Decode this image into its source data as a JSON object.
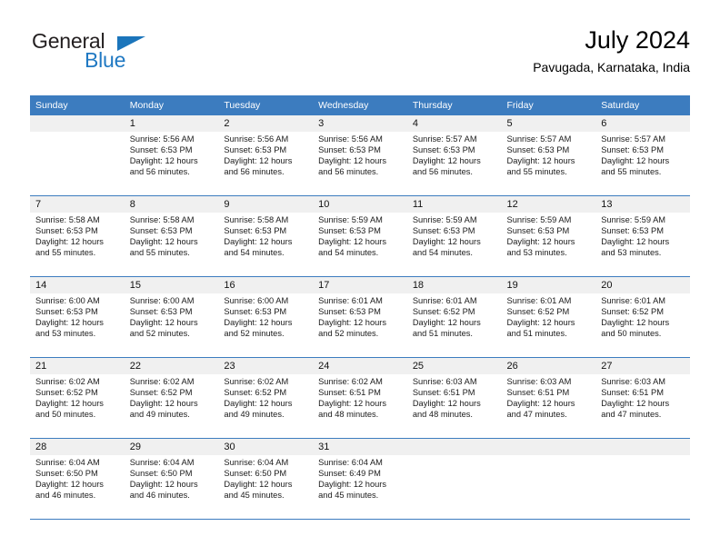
{
  "brand": {
    "name_part1": "General",
    "name_part2": "Blue",
    "triangle_icon": "triangle-icon",
    "accent_color": "#1b75bb"
  },
  "header": {
    "title": "July 2024",
    "subtitle": "Pavugada, Karnataka, India"
  },
  "calendar": {
    "header_color": "#3c7cbf",
    "daynum_bg": "#f0f0f0",
    "weekday_headers": [
      "Sunday",
      "Monday",
      "Tuesday",
      "Wednesday",
      "Thursday",
      "Friday",
      "Saturday"
    ],
    "weeks": [
      [
        {
          "day": "",
          "sunrise": "",
          "sunset": "",
          "daylight1": "",
          "daylight2": ""
        },
        {
          "day": "1",
          "sunrise": "Sunrise: 5:56 AM",
          "sunset": "Sunset: 6:53 PM",
          "daylight1": "Daylight: 12 hours",
          "daylight2": "and 56 minutes."
        },
        {
          "day": "2",
          "sunrise": "Sunrise: 5:56 AM",
          "sunset": "Sunset: 6:53 PM",
          "daylight1": "Daylight: 12 hours",
          "daylight2": "and 56 minutes."
        },
        {
          "day": "3",
          "sunrise": "Sunrise: 5:56 AM",
          "sunset": "Sunset: 6:53 PM",
          "daylight1": "Daylight: 12 hours",
          "daylight2": "and 56 minutes."
        },
        {
          "day": "4",
          "sunrise": "Sunrise: 5:57 AM",
          "sunset": "Sunset: 6:53 PM",
          "daylight1": "Daylight: 12 hours",
          "daylight2": "and 56 minutes."
        },
        {
          "day": "5",
          "sunrise": "Sunrise: 5:57 AM",
          "sunset": "Sunset: 6:53 PM",
          "daylight1": "Daylight: 12 hours",
          "daylight2": "and 55 minutes."
        },
        {
          "day": "6",
          "sunrise": "Sunrise: 5:57 AM",
          "sunset": "Sunset: 6:53 PM",
          "daylight1": "Daylight: 12 hours",
          "daylight2": "and 55 minutes."
        }
      ],
      [
        {
          "day": "7",
          "sunrise": "Sunrise: 5:58 AM",
          "sunset": "Sunset: 6:53 PM",
          "daylight1": "Daylight: 12 hours",
          "daylight2": "and 55 minutes."
        },
        {
          "day": "8",
          "sunrise": "Sunrise: 5:58 AM",
          "sunset": "Sunset: 6:53 PM",
          "daylight1": "Daylight: 12 hours",
          "daylight2": "and 55 minutes."
        },
        {
          "day": "9",
          "sunrise": "Sunrise: 5:58 AM",
          "sunset": "Sunset: 6:53 PM",
          "daylight1": "Daylight: 12 hours",
          "daylight2": "and 54 minutes."
        },
        {
          "day": "10",
          "sunrise": "Sunrise: 5:59 AM",
          "sunset": "Sunset: 6:53 PM",
          "daylight1": "Daylight: 12 hours",
          "daylight2": "and 54 minutes."
        },
        {
          "day": "11",
          "sunrise": "Sunrise: 5:59 AM",
          "sunset": "Sunset: 6:53 PM",
          "daylight1": "Daylight: 12 hours",
          "daylight2": "and 54 minutes."
        },
        {
          "day": "12",
          "sunrise": "Sunrise: 5:59 AM",
          "sunset": "Sunset: 6:53 PM",
          "daylight1": "Daylight: 12 hours",
          "daylight2": "and 53 minutes."
        },
        {
          "day": "13",
          "sunrise": "Sunrise: 5:59 AM",
          "sunset": "Sunset: 6:53 PM",
          "daylight1": "Daylight: 12 hours",
          "daylight2": "and 53 minutes."
        }
      ],
      [
        {
          "day": "14",
          "sunrise": "Sunrise: 6:00 AM",
          "sunset": "Sunset: 6:53 PM",
          "daylight1": "Daylight: 12 hours",
          "daylight2": "and 53 minutes."
        },
        {
          "day": "15",
          "sunrise": "Sunrise: 6:00 AM",
          "sunset": "Sunset: 6:53 PM",
          "daylight1": "Daylight: 12 hours",
          "daylight2": "and 52 minutes."
        },
        {
          "day": "16",
          "sunrise": "Sunrise: 6:00 AM",
          "sunset": "Sunset: 6:53 PM",
          "daylight1": "Daylight: 12 hours",
          "daylight2": "and 52 minutes."
        },
        {
          "day": "17",
          "sunrise": "Sunrise: 6:01 AM",
          "sunset": "Sunset: 6:53 PM",
          "daylight1": "Daylight: 12 hours",
          "daylight2": "and 52 minutes."
        },
        {
          "day": "18",
          "sunrise": "Sunrise: 6:01 AM",
          "sunset": "Sunset: 6:52 PM",
          "daylight1": "Daylight: 12 hours",
          "daylight2": "and 51 minutes."
        },
        {
          "day": "19",
          "sunrise": "Sunrise: 6:01 AM",
          "sunset": "Sunset: 6:52 PM",
          "daylight1": "Daylight: 12 hours",
          "daylight2": "and 51 minutes."
        },
        {
          "day": "20",
          "sunrise": "Sunrise: 6:01 AM",
          "sunset": "Sunset: 6:52 PM",
          "daylight1": "Daylight: 12 hours",
          "daylight2": "and 50 minutes."
        }
      ],
      [
        {
          "day": "21",
          "sunrise": "Sunrise: 6:02 AM",
          "sunset": "Sunset: 6:52 PM",
          "daylight1": "Daylight: 12 hours",
          "daylight2": "and 50 minutes."
        },
        {
          "day": "22",
          "sunrise": "Sunrise: 6:02 AM",
          "sunset": "Sunset: 6:52 PM",
          "daylight1": "Daylight: 12 hours",
          "daylight2": "and 49 minutes."
        },
        {
          "day": "23",
          "sunrise": "Sunrise: 6:02 AM",
          "sunset": "Sunset: 6:52 PM",
          "daylight1": "Daylight: 12 hours",
          "daylight2": "and 49 minutes."
        },
        {
          "day": "24",
          "sunrise": "Sunrise: 6:02 AM",
          "sunset": "Sunset: 6:51 PM",
          "daylight1": "Daylight: 12 hours",
          "daylight2": "and 48 minutes."
        },
        {
          "day": "25",
          "sunrise": "Sunrise: 6:03 AM",
          "sunset": "Sunset: 6:51 PM",
          "daylight1": "Daylight: 12 hours",
          "daylight2": "and 48 minutes."
        },
        {
          "day": "26",
          "sunrise": "Sunrise: 6:03 AM",
          "sunset": "Sunset: 6:51 PM",
          "daylight1": "Daylight: 12 hours",
          "daylight2": "and 47 minutes."
        },
        {
          "day": "27",
          "sunrise": "Sunrise: 6:03 AM",
          "sunset": "Sunset: 6:51 PM",
          "daylight1": "Daylight: 12 hours",
          "daylight2": "and 47 minutes."
        }
      ],
      [
        {
          "day": "28",
          "sunrise": "Sunrise: 6:04 AM",
          "sunset": "Sunset: 6:50 PM",
          "daylight1": "Daylight: 12 hours",
          "daylight2": "and 46 minutes."
        },
        {
          "day": "29",
          "sunrise": "Sunrise: 6:04 AM",
          "sunset": "Sunset: 6:50 PM",
          "daylight1": "Daylight: 12 hours",
          "daylight2": "and 46 minutes."
        },
        {
          "day": "30",
          "sunrise": "Sunrise: 6:04 AM",
          "sunset": "Sunset: 6:50 PM",
          "daylight1": "Daylight: 12 hours",
          "daylight2": "and 45 minutes."
        },
        {
          "day": "31",
          "sunrise": "Sunrise: 6:04 AM",
          "sunset": "Sunset: 6:49 PM",
          "daylight1": "Daylight: 12 hours",
          "daylight2": "and 45 minutes."
        },
        {
          "day": "",
          "sunrise": "",
          "sunset": "",
          "daylight1": "",
          "daylight2": ""
        },
        {
          "day": "",
          "sunrise": "",
          "sunset": "",
          "daylight1": "",
          "daylight2": ""
        },
        {
          "day": "",
          "sunrise": "",
          "sunset": "",
          "daylight1": "",
          "daylight2": ""
        }
      ]
    ]
  }
}
